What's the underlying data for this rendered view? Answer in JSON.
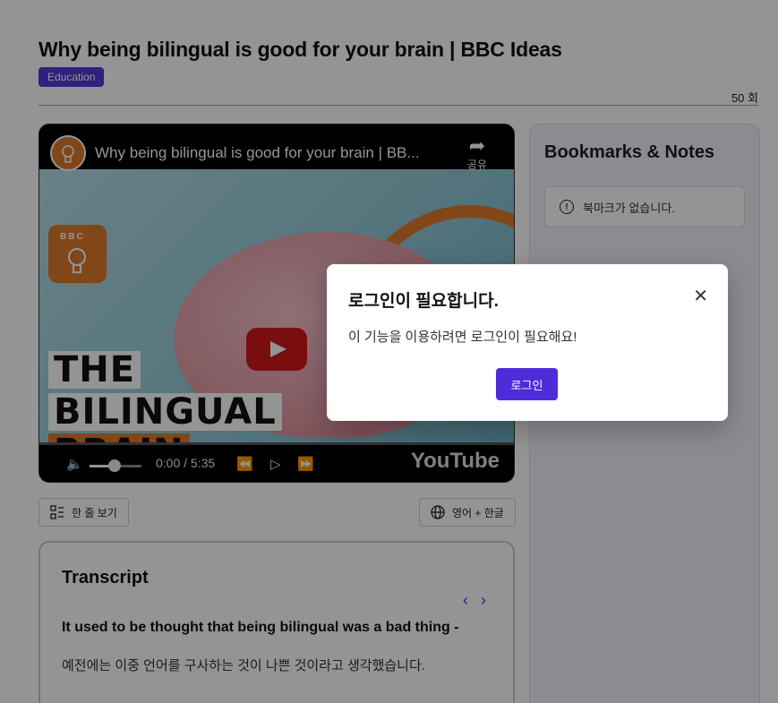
{
  "header": {
    "title": "Why being bilingual is good for your brain | BBC Ideas",
    "category": "Education",
    "views": "50 회"
  },
  "video": {
    "title": "Why being bilingual is good for your brain | BB...",
    "share_label": "공유",
    "thumbnail_text": [
      "THE",
      "BILINGUAL",
      "BRAIN"
    ],
    "bbc_label": "BBC",
    "time": "0:00 / 5:35",
    "youtube_label": "YouTube",
    "volume_level": 0.4
  },
  "controls": {
    "one_line_label": "한 줄 보기",
    "language_label": "영어 + 한글"
  },
  "transcript": {
    "title": "Transcript",
    "english": "It used to be thought that being bilingual was a bad thing -",
    "korean": "예전에는 이중 언어를 구사하는 것이 나쁜 것이라고 생각했습니다."
  },
  "sidebar": {
    "title": "Bookmarks & Notes",
    "empty_message": "북마크가 없습니다."
  },
  "modal": {
    "title": "로그인이 필요합니다.",
    "message": "이 기능을 이용하려면 로그인이 필요해요!",
    "button_label": "로그인"
  },
  "colors": {
    "accent": "#4f2bd9",
    "badge": "#4f3bd9",
    "bbc_orange": "#e07a2c"
  }
}
